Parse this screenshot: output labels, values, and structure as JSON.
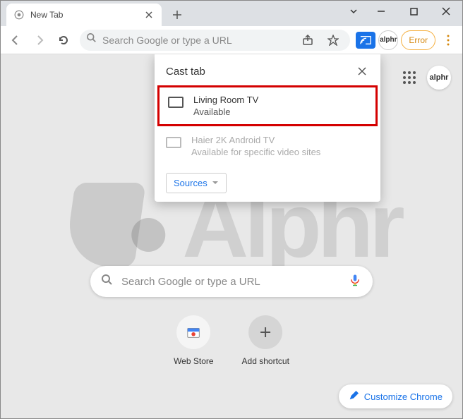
{
  "titlebar": {
    "tab_title": "New Tab"
  },
  "toolbar": {
    "omnibox_placeholder": "Search Google or type a URL",
    "profile_label": "alphr",
    "error_label": "Error"
  },
  "cast": {
    "title": "Cast tab",
    "devices": [
      {
        "name": "Living Room TV",
        "status": "Available"
      },
      {
        "name": "Haier 2K Android TV",
        "status": "Available for specific video sites"
      }
    ],
    "sources_label": "Sources"
  },
  "content": {
    "profile_label": "alphr",
    "search_placeholder": "Search Google or type a URL",
    "shortcuts": [
      {
        "label": "Web Store"
      },
      {
        "label": "Add shortcut"
      }
    ],
    "customize_label": "Customize Chrome",
    "watermark_text": "Alphr"
  }
}
